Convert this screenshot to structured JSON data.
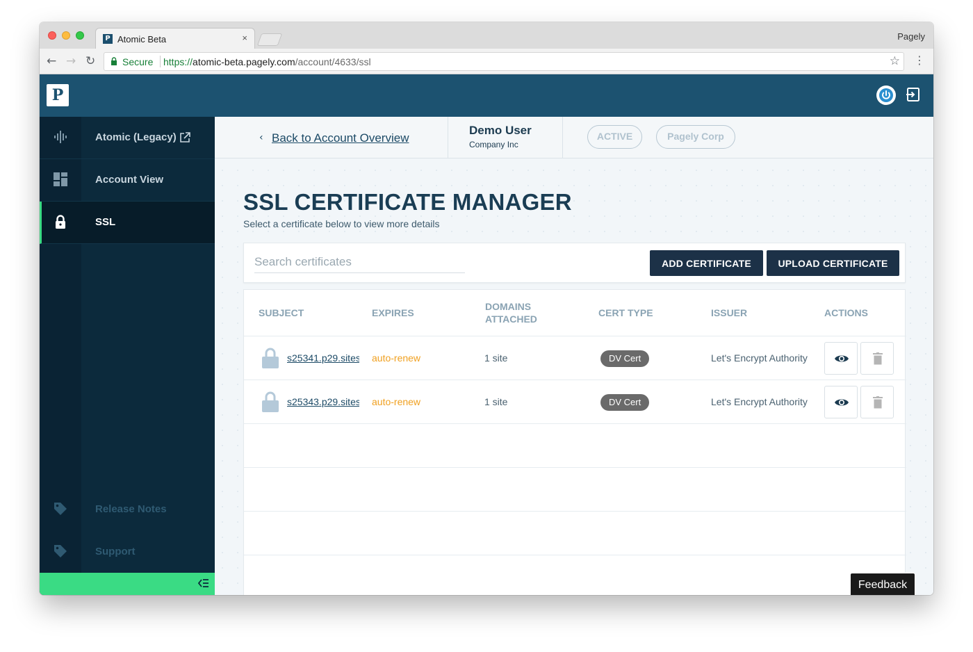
{
  "browser": {
    "tab_title": "Atomic Beta",
    "tab_close": "×",
    "profile_name": "Pagely",
    "secure_label": "Secure",
    "url_scheme": "https://",
    "url_host": "atomic-beta.pagely.com",
    "url_path": "/account/4633/ssl"
  },
  "header": {
    "logo_letter": "P"
  },
  "sidebar": {
    "items": [
      {
        "label": "Atomic (Legacy)",
        "icon": "waveform-icon"
      },
      {
        "label": "Account View",
        "icon": "dashboard-icon"
      },
      {
        "label": "SSL",
        "icon": "lock-icon"
      }
    ],
    "footer_items": [
      {
        "label": "Release Notes",
        "icon": "tag-icon"
      },
      {
        "label": "Support",
        "icon": "tag-icon"
      }
    ]
  },
  "subnav": {
    "back_label": "Back to Account Overview",
    "user_name": "Demo User",
    "company": "Company Inc",
    "pills": [
      "ACTIVE",
      "Pagely Corp"
    ]
  },
  "page": {
    "title": "SSL CERTIFICATE MANAGER",
    "subtitle": "Select a certificate below to view more details",
    "search_placeholder": "Search certificates",
    "add_button": "ADD CERTIFICATE",
    "upload_button": "UPLOAD CERTIFICATE"
  },
  "table": {
    "columns": [
      "SUBJECT",
      "EXPIRES",
      "DOMAINS ATTACHED",
      "CERT TYPE",
      "ISSUER",
      "ACTIONS"
    ],
    "rows": [
      {
        "subject": "s25341.p29.sites.",
        "expires": "auto-renew",
        "domains": "1 site",
        "cert_type": "DV Cert",
        "issuer": "Let's Encrypt Authority"
      },
      {
        "subject": "s25343.p29.sites",
        "expires": "auto-renew",
        "domains": "1 site",
        "cert_type": "DV Cert",
        "issuer": "Let's Encrypt Authority"
      }
    ]
  },
  "feedback_label": "Feedback",
  "colors": {
    "header": "#1c5270",
    "sidebar": "#0c2a3c",
    "accent_green": "#3adb84",
    "button_dark": "#1c3147",
    "expires_orange": "#f0a020"
  }
}
